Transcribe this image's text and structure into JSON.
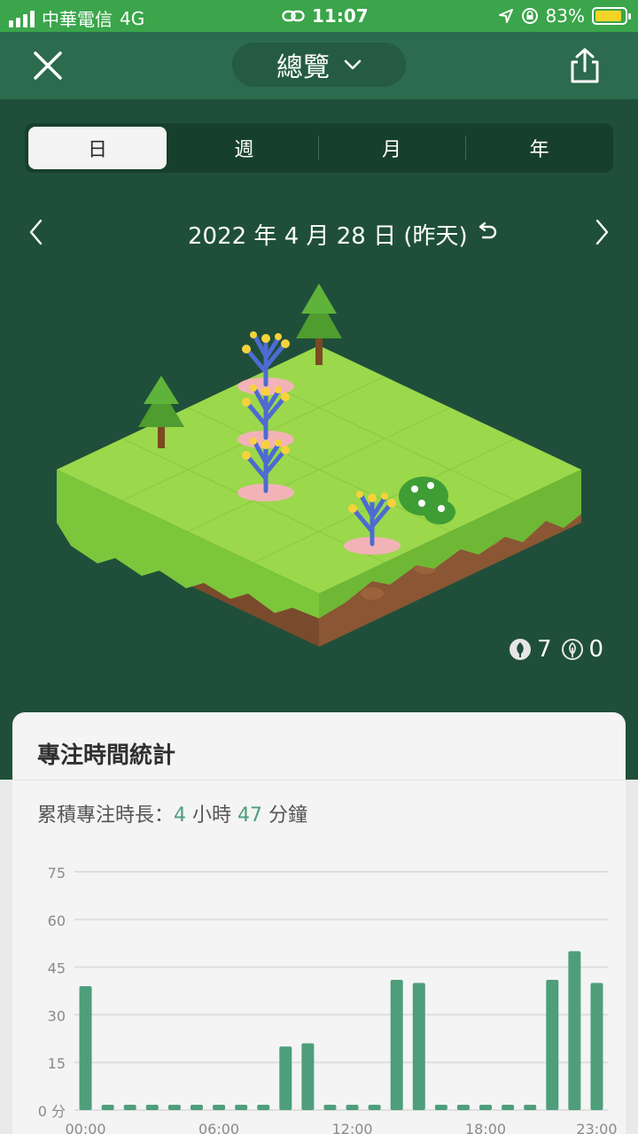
{
  "status_bar": {
    "carrier": "中華電信",
    "network": "4G",
    "time": "11:07",
    "battery": "83%"
  },
  "header": {
    "title": "總覽",
    "close_icon": "close-icon",
    "share_icon": "share-icon"
  },
  "tabs": [
    {
      "label": "日",
      "active": true
    },
    {
      "label": "週",
      "active": false
    },
    {
      "label": "月",
      "active": false
    },
    {
      "label": "年",
      "active": false
    }
  ],
  "date": {
    "text": "2022 年 4 月 28 日 (昨天)"
  },
  "forest": {
    "healthy_count": "7",
    "withered_count": "0"
  },
  "stats": {
    "title": "專注時間統計",
    "summary_prefix": "累積專注時長：",
    "hours": "4",
    "hours_unit": "小時",
    "minutes": "47",
    "minutes_unit": "分鐘"
  },
  "colors": {
    "header": "#2c6b4e",
    "background": "#1f4f3a",
    "status_bar": "#3aa54a",
    "bar": "#4e9e7c"
  },
  "chart_data": {
    "type": "bar",
    "categories": [
      "00:00",
      "01:00",
      "02:00",
      "03:00",
      "04:00",
      "05:00",
      "06:00",
      "07:00",
      "08:00",
      "09:00",
      "10:00",
      "11:00",
      "12:00",
      "13:00",
      "14:00",
      "15:00",
      "16:00",
      "17:00",
      "18:00",
      "19:00",
      "20:00",
      "21:00",
      "22:00",
      "23:00"
    ],
    "values": [
      39,
      0,
      0,
      0,
      0,
      0,
      0,
      0,
      0,
      20,
      21,
      0,
      0,
      0,
      41,
      40,
      0,
      0,
      0,
      0,
      0,
      41,
      50,
      40
    ],
    "ylim": [
      0,
      75
    ],
    "yticks": [
      "0 分",
      "15",
      "30",
      "45",
      "60",
      "75"
    ],
    "xtick_labels": [
      "00:00",
      "06:00",
      "12:00",
      "18:00",
      "23:00"
    ],
    "xtick_index": [
      0,
      6,
      12,
      18,
      23
    ],
    "grid": true
  }
}
